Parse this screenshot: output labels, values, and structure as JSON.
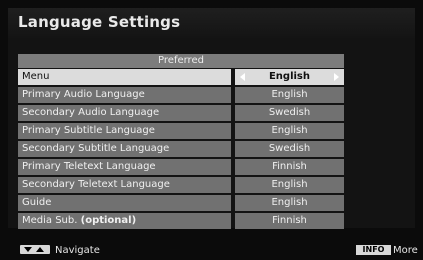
{
  "screen": {
    "title": "Language Settings",
    "header": "Preferred"
  },
  "rows": [
    {
      "label": "Menu",
      "value": "English",
      "selected": true
    },
    {
      "label": "Primary Audio Language",
      "value": "English"
    },
    {
      "label": "Secondary Audio Language",
      "value": "Swedish"
    },
    {
      "label": "Primary Subtitle Language",
      "value": "English"
    },
    {
      "label": "Secondary Subtitle Language",
      "value": "Swedish"
    },
    {
      "label": "Primary Teletext Language",
      "value": "Finnish"
    },
    {
      "label": "Secondary Teletext Language",
      "value": "English"
    },
    {
      "label": "Guide",
      "value": "English"
    },
    {
      "label": "Media Sub.",
      "label_suffix": "(optional)",
      "value": "Finnish"
    }
  ],
  "footer": {
    "navigate_label": "Navigate",
    "info_key_label": "INFO",
    "more_label": "More"
  },
  "colors": {
    "background": "#0b0b0b",
    "row": "#717171",
    "row_selected": "#dcdcdc",
    "header": "#7c7c7c"
  }
}
